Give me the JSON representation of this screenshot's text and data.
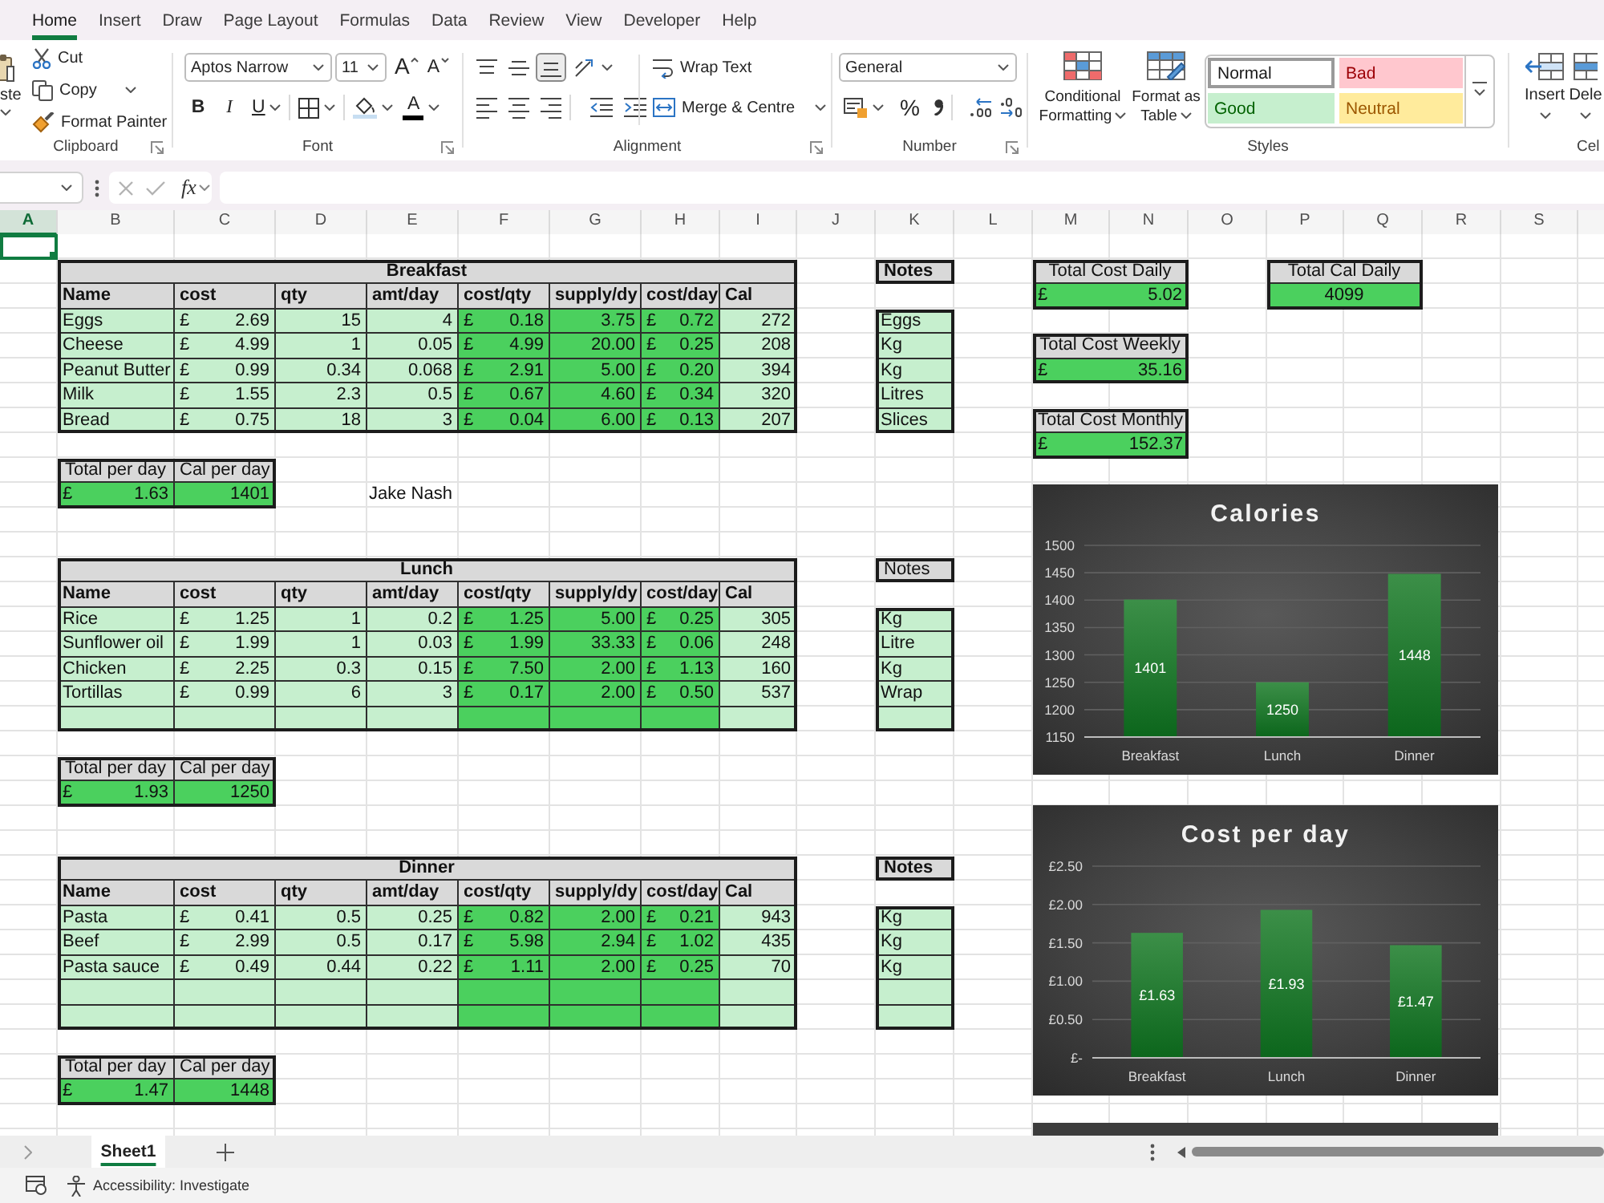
{
  "ribbon_tabs": [
    {
      "label": "Home",
      "selected": true
    },
    {
      "label": "Insert",
      "selected": false
    },
    {
      "label": "Draw",
      "selected": false
    },
    {
      "label": "Page Layout",
      "selected": false
    },
    {
      "label": "Formulas",
      "selected": false
    },
    {
      "label": "Data",
      "selected": false
    },
    {
      "label": "Review",
      "selected": false
    },
    {
      "label": "View",
      "selected": false
    },
    {
      "label": "Developer",
      "selected": false
    },
    {
      "label": "Help",
      "selected": false
    }
  ],
  "ribbon": {
    "clipboard": {
      "title": "Clipboard",
      "paste": "ste",
      "cut": "Cut",
      "copy": "Copy",
      "format_painter": "Format Painter"
    },
    "font": {
      "title": "Font",
      "font_name": "Aptos Narrow",
      "font_size": "11",
      "grow": "A",
      "shrink": "A",
      "bold": "B",
      "italic": "I",
      "underline": "U",
      "font_color": "A"
    },
    "alignment": {
      "title": "Alignment",
      "vertical_align": [
        {
          "kind": "top",
          "selected": false
        },
        {
          "kind": "middle",
          "selected": false
        },
        {
          "kind": "bottom",
          "selected": true
        }
      ],
      "wrap_text": "Wrap Text",
      "merge": "Merge & Centre"
    },
    "number": {
      "title": "Number",
      "format": "General",
      "percent": "%"
    },
    "styles": {
      "title": "Styles",
      "conditional_formatting": "Conditional Formatting",
      "format_as_table": "Format as Table",
      "gallery": [
        {
          "label": "Normal",
          "kind": "normal"
        },
        {
          "label": "Bad",
          "kind": "bad"
        },
        {
          "label": "Good",
          "kind": "good"
        },
        {
          "label": "Neutral",
          "kind": "neutral"
        }
      ]
    },
    "cells": {
      "title": "Cel",
      "insert": "Insert",
      "delete": "Dele"
    }
  },
  "formula_bar": {
    "function_label": "fx",
    "edit_disabled": true
  },
  "sheet": {
    "columns": [
      {
        "label": "A",
        "selected": true
      },
      {
        "label": "B",
        "selected": false
      },
      {
        "label": "C",
        "selected": false
      },
      {
        "label": "D",
        "selected": false
      },
      {
        "label": "E",
        "selected": false
      },
      {
        "label": "F",
        "selected": false
      },
      {
        "label": "G",
        "selected": false
      },
      {
        "label": "H",
        "selected": false
      },
      {
        "label": "I",
        "selected": false
      },
      {
        "label": "J",
        "selected": false
      },
      {
        "label": "K",
        "selected": false
      },
      {
        "label": "L",
        "selected": false
      },
      {
        "label": "M",
        "selected": false
      },
      {
        "label": "N",
        "selected": false
      },
      {
        "label": "O",
        "selected": false
      },
      {
        "label": "P",
        "selected": false
      },
      {
        "label": "Q",
        "selected": false
      },
      {
        "label": "R",
        "selected": false
      },
      {
        "label": "S",
        "selected": false
      }
    ],
    "meals": [
      {
        "title": "Breakfast",
        "columns": [
          {
            "label": "Name",
            "kind": "input"
          },
          {
            "label": "cost",
            "kind": "input"
          },
          {
            "label": "qty",
            "kind": "input"
          },
          {
            "label": "amt/day",
            "kind": "input"
          },
          {
            "label": "cost/qty",
            "kind": "computed"
          },
          {
            "label": "supply/dy",
            "kind": "computed"
          },
          {
            "label": "cost/day",
            "kind": "computed"
          },
          {
            "label": "Cal",
            "kind": "input"
          }
        ],
        "rows": [
          {
            "kind": "item",
            "cells": [
              "Eggs",
              {
                "currency": "£",
                "amount": "2.69"
              },
              "15",
              "4",
              {
                "currency": "£",
                "amount": "0.18"
              },
              "3.75",
              {
                "currency": "£",
                "amount": "0.72"
              },
              "272"
            ],
            "note": "Eggs"
          },
          {
            "kind": "item",
            "cells": [
              "Cheese",
              {
                "currency": "£",
                "amount": "4.99"
              },
              "1",
              "0.05",
              {
                "currency": "£",
                "amount": "4.99"
              },
              "20.00",
              {
                "currency": "£",
                "amount": "0.25"
              },
              "208"
            ],
            "note": "Kg"
          },
          {
            "kind": "item",
            "cells": [
              "Peanut Butter",
              {
                "currency": "£",
                "amount": "0.99"
              },
              "0.34",
              "0.068",
              {
                "currency": "£",
                "amount": "2.91"
              },
              "5.00",
              {
                "currency": "£",
                "amount": "0.20"
              },
              "394"
            ],
            "note": "Kg"
          },
          {
            "kind": "item",
            "cells": [
              "Milk",
              {
                "currency": "£",
                "amount": "1.55"
              },
              "2.3",
              "0.5",
              {
                "currency": "£",
                "amount": "0.67"
              },
              "4.60",
              {
                "currency": "£",
                "amount": "0.34"
              },
              "320"
            ],
            "note": "Litres"
          },
          {
            "kind": "item",
            "cells": [
              "Bread",
              {
                "currency": "£",
                "amount": "0.75"
              },
              "18",
              "3",
              {
                "currency": "£",
                "amount": "0.04"
              },
              "6.00",
              {
                "currency": "£",
                "amount": "0.13"
              },
              "207"
            ],
            "note": "Slices"
          }
        ],
        "notes_title": {
          "label": "Notes",
          "bold": true
        },
        "totals": {
          "headers": [
            "Total per day",
            "Cal per day"
          ],
          "cost": {
            "currency": "£",
            "amount": "1.63"
          },
          "calories": "1401"
        }
      },
      {
        "title": "Lunch",
        "columns": [
          {
            "label": "Name",
            "kind": "input"
          },
          {
            "label": "cost",
            "kind": "input"
          },
          {
            "label": "qty",
            "kind": "input"
          },
          {
            "label": "amt/day",
            "kind": "input"
          },
          {
            "label": "cost/qty",
            "kind": "computed"
          },
          {
            "label": "supply/dy",
            "kind": "computed"
          },
          {
            "label": "cost/day",
            "kind": "computed"
          },
          {
            "label": "Cal",
            "kind": "input"
          }
        ],
        "rows": [
          {
            "kind": "item",
            "cells": [
              "Rice",
              {
                "currency": "£",
                "amount": "1.25"
              },
              "1",
              "0.2",
              {
                "currency": "£",
                "amount": "1.25"
              },
              "5.00",
              {
                "currency": "£",
                "amount": "0.25"
              },
              "305"
            ],
            "note": "Kg"
          },
          {
            "kind": "item",
            "cells": [
              "Sunflower oil",
              {
                "currency": "£",
                "amount": "1.99"
              },
              "1",
              "0.03",
              {
                "currency": "£",
                "amount": "1.99"
              },
              "33.33",
              {
                "currency": "£",
                "amount": "0.06"
              },
              "248"
            ],
            "note": "Litre"
          },
          {
            "kind": "item",
            "cells": [
              "Chicken",
              {
                "currency": "£",
                "amount": "2.25"
              },
              "0.3",
              "0.15",
              {
                "currency": "£",
                "amount": "7.50"
              },
              "2.00",
              {
                "currency": "£",
                "amount": "1.13"
              },
              "160"
            ],
            "note": "Kg"
          },
          {
            "kind": "item",
            "cells": [
              "Tortillas",
              {
                "currency": "£",
                "amount": "0.99"
              },
              "6",
              "3",
              {
                "currency": "£",
                "amount": "0.17"
              },
              "2.00",
              {
                "currency": "£",
                "amount": "0.50"
              },
              "537"
            ],
            "note": "Wrap"
          },
          {
            "kind": "blank"
          }
        ],
        "notes_title": {
          "label": "Notes",
          "bold": false
        },
        "totals": {
          "headers": [
            "Total per day",
            "Cal per day"
          ],
          "cost": {
            "currency": "£",
            "amount": "1.93"
          },
          "calories": "1250"
        }
      },
      {
        "title": "Dinner",
        "columns": [
          {
            "label": "Name",
            "kind": "input"
          },
          {
            "label": "cost",
            "kind": "input"
          },
          {
            "label": "qty",
            "kind": "input"
          },
          {
            "label": "amt/day",
            "kind": "input"
          },
          {
            "label": "cost/qty",
            "kind": "computed"
          },
          {
            "label": "supply/dy",
            "kind": "computed"
          },
          {
            "label": "cost/day",
            "kind": "computed"
          },
          {
            "label": "Cal",
            "kind": "input"
          }
        ],
        "rows": [
          {
            "kind": "item",
            "cells": [
              "Pasta",
              {
                "currency": "£",
                "amount": "0.41"
              },
              "0.5",
              "0.25",
              {
                "currency": "£",
                "amount": "0.82"
              },
              "2.00",
              {
                "currency": "£",
                "amount": "0.21"
              },
              "943"
            ],
            "note": "Kg"
          },
          {
            "kind": "item",
            "cells": [
              "Beef",
              {
                "currency": "£",
                "amount": "2.99"
              },
              "0.5",
              "0.17",
              {
                "currency": "£",
                "amount": "5.98"
              },
              "2.94",
              {
                "currency": "£",
                "amount": "1.02"
              },
              "435"
            ],
            "note": "Kg"
          },
          {
            "kind": "item",
            "cells": [
              "Pasta sauce",
              {
                "currency": "£",
                "amount": "0.49"
              },
              "0.44",
              "0.22",
              {
                "currency": "£",
                "amount": "1.11"
              },
              "2.00",
              {
                "currency": "£",
                "amount": "0.25"
              },
              "70"
            ],
            "note": "Kg"
          },
          {
            "kind": "blank"
          },
          {
            "kind": "blank"
          }
        ],
        "notes_title": {
          "label": "Notes",
          "bold": true
        },
        "totals": {
          "headers": [
            "Total per day",
            "Cal per day"
          ],
          "cost": {
            "currency": "£",
            "amount": "1.47"
          },
          "calories": "1448"
        }
      }
    ],
    "author_note": "Jake Nash",
    "summaries": [
      {
        "label": "Total Cost Daily",
        "value": {
          "currency": "£",
          "amount": "5.02"
        }
      },
      {
        "label": "Total Cost Weekly",
        "value": {
          "currency": "£",
          "amount": "35.16"
        }
      },
      {
        "label": "Total Cost Monthly",
        "value": {
          "currency": "£",
          "amount": "152.37"
        }
      }
    ],
    "calorie_summary": {
      "label": "Total Cal Daily",
      "value": "4099"
    },
    "charts": [
      {
        "chart_data": {
          "type": "bar",
          "title": "Calories",
          "categories": [
            "Breakfast",
            "Lunch",
            "Dinner"
          ],
          "values": [
            1401,
            1250,
            1448
          ],
          "ylim": [
            1150,
            1500
          ],
          "yticks": [
            1150,
            1200,
            1250,
            1300,
            1350,
            1400,
            1450,
            1500
          ],
          "grid": true,
          "data_labels": true
        }
      },
      {
        "chart_data": {
          "type": "bar",
          "title": "Cost per day",
          "categories": [
            "Breakfast",
            "Lunch",
            "Dinner"
          ],
          "values": [
            1.63,
            1.93,
            1.47
          ],
          "ylim": [
            0,
            2.5
          ],
          "yticks": [
            {
              "value": 0,
              "label": "£-"
            },
            {
              "value": 0.5,
              "label": "£0.50"
            },
            {
              "value": 1,
              "label": "£1.00"
            },
            {
              "value": 1.5,
              "label": "£1.50"
            },
            {
              "value": 2,
              "label": "£2.00"
            },
            {
              "value": 2.5,
              "label": "£2.50"
            }
          ],
          "grid": true,
          "value_labels": [
            "£1.63",
            "£1.93",
            "£1.47"
          ]
        }
      }
    ]
  },
  "sheet_tabs": [
    {
      "label": "Sheet1",
      "selected": true
    }
  ],
  "status_bar": {
    "accessibility": "Accessibility: Investigate"
  }
}
